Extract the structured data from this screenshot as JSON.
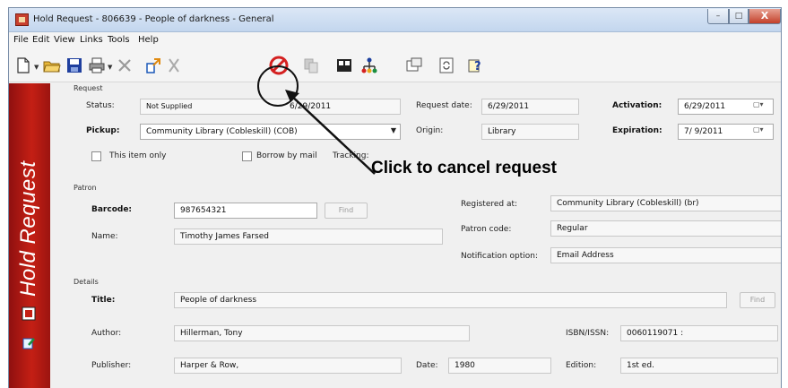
{
  "window": {
    "title": "Hold Request - 806639 - People of darkness - General",
    "minimize": "–",
    "maximize": "□",
    "close": "X"
  },
  "menu": [
    "File",
    "Edit",
    "View",
    "Links",
    "Tools",
    "Help"
  ],
  "toolbar": {
    "icons": [
      "new-icon",
      "open-icon",
      "save-icon",
      "print-icon",
      "delete-icon",
      "link-icon",
      "cut-icon",
      "cancel-request-icon",
      "copy-icon",
      "reader-icon",
      "tree-icon",
      "properties-icon",
      "refresh-icon",
      "help-icon"
    ]
  },
  "sidebar": {
    "title": "Hold Request"
  },
  "request": {
    "section_label": "Request",
    "status_label": "Status:",
    "status_value": "Not Supplied",
    "status_date": "6/29/2011",
    "request_date_label": "Request date:",
    "request_date_value": "6/29/2011",
    "activation_label": "Activation:",
    "activation_value": "6/29/2011",
    "pickup_label": "Pickup:",
    "pickup_value": "Community Library (Cobleskill) (COB)",
    "origin_label": "Origin:",
    "origin_value": "Library",
    "expiration_label": "Expiration:",
    "expiration_value": "7/ 9/2011",
    "this_item_only_label": "This item only",
    "borrow_by_mail_label": "Borrow by mail",
    "tracking_label": "Tracking:"
  },
  "annotation": {
    "callout": "Click to cancel request"
  },
  "patron": {
    "section_label": "Patron",
    "barcode_label": "Barcode:",
    "barcode_value": "987654321",
    "find_label": "Find",
    "registered_at_label": "Registered at:",
    "registered_at_value": "Community Library (Cobleskill) (br)",
    "name_label": "Name:",
    "name_value": "Timothy James Farsed",
    "patron_code_label": "Patron code:",
    "patron_code_value": "Regular",
    "notification_label": "Notification option:",
    "notification_value": "Email Address"
  },
  "details": {
    "section_label": "Details",
    "title_label": "Title:",
    "title_value": "People of darkness",
    "find_label": "Find",
    "author_label": "Author:",
    "author_value": "Hillerman, Tony",
    "isbn_label": "ISBN/ISSN:",
    "isbn_value": "0060119071 :",
    "publisher_label": "Publisher:",
    "publisher_value": "Harper & Row,",
    "date_label": "Date:",
    "date_value": "1980",
    "edition_label": "Edition:",
    "edition_value": "1st ed."
  },
  "colors": {
    "sidebar_red": "#c41f14",
    "cancel_icon_red": "#d42020"
  }
}
